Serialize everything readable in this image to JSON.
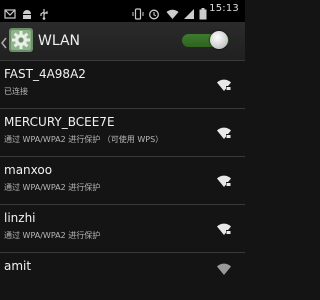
{
  "status_bar": {
    "time": "15:13",
    "icons": [
      "notification-icon",
      "android-icon",
      "usb-icon",
      "alarm-icon",
      "vibrate-icon",
      "wifi-icon",
      "signal-icon",
      "battery-icon"
    ]
  },
  "action_bar": {
    "title": "WLAN",
    "wlan_enabled": true
  },
  "networks": [
    {
      "name": "FAST_4A98A2",
      "status": "已连接"
    },
    {
      "name": "MERCURY_BCEE7E",
      "status": "通过 WPA/WPA2 进行保护 （可使用 WPS）"
    },
    {
      "name": "manxoo",
      "status": "通过 WPA/WPA2 进行保护"
    },
    {
      "name": "linzhi",
      "status": "通过 WPA/WPA2 进行保护"
    },
    {
      "name": "amit",
      "status": ""
    }
  ],
  "colors": {
    "background": "#141414",
    "toggle_on": "#3f7a2e",
    "divider": "#3a3a3a"
  }
}
